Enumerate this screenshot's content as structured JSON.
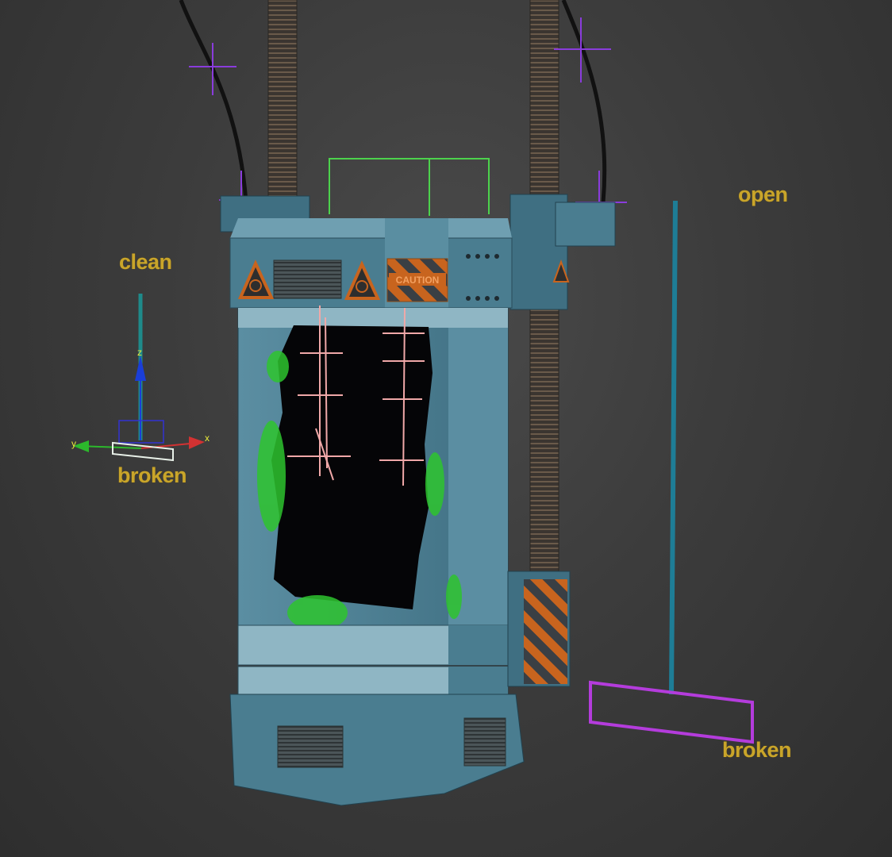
{
  "viewport": {
    "labels": {
      "clean": "clean",
      "broken_left": "broken",
      "open": "open",
      "broken_right": "broken"
    },
    "gizmo_axes": {
      "x": "x",
      "y": "y",
      "z": "z"
    },
    "warning_sign_text": "CAUTION"
  },
  "colors": {
    "background": "#3c3c3c",
    "label": "#c9a52a",
    "tank_body": "#4a7d90",
    "tank_dark": "#2f5566",
    "caution_orange": "#c8641e",
    "slime_green": "#2ec42e",
    "helper_green": "#4cd24c",
    "helper_purple": "#b43cdc",
    "rail_teal": "#1e7d96",
    "bone_pink": "#f0a8a8",
    "gizmo_x": "#d23232",
    "gizmo_y": "#32b432",
    "gizmo_z": "#3232d2"
  },
  "icons": [
    "biohazard-icon",
    "caution-stripes",
    "point-helper-icon",
    "transform-gizmo-icon"
  ]
}
